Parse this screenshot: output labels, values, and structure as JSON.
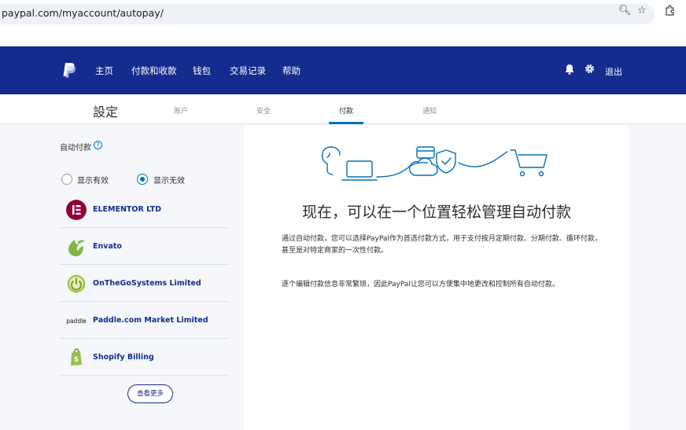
{
  "browser": {
    "url": "paypal.com/myaccount/autopay/",
    "zoom_icon": "zoom-icon",
    "bookmark_icon": "star-icon",
    "extensions_icon": "puzzle-icon"
  },
  "header": {
    "nav": [
      "主页",
      "付款和收款",
      "钱包",
      "交易记录",
      "帮助"
    ],
    "logout": "退出",
    "bg_color": "#142c8e"
  },
  "settings": {
    "title": "設定",
    "tabs": [
      "账户",
      "安全",
      "付款",
      "通知"
    ],
    "active_tab": "付款"
  },
  "left": {
    "autopay_label": "自动付款",
    "filters": [
      {
        "label": "显示有效",
        "checked": false
      },
      {
        "label": "显示无效",
        "checked": true
      }
    ],
    "merchants": [
      {
        "name": "ELEMENTOR LTD",
        "icon": "elementor-logo-icon"
      },
      {
        "name": "Envato",
        "icon": "envato-logo-icon"
      },
      {
        "name": "OnTheGoSystems Limited",
        "icon": "power-logo-icon"
      },
      {
        "name": "Paddle.com Market Limited",
        "icon": "paddle-logo-icon"
      },
      {
        "name": "Shopify Billing",
        "icon": "shopify-logo-icon"
      }
    ],
    "see_more": "查看更多"
  },
  "right": {
    "headline": "现在，可以在一个位置轻松管理自动付款",
    "para1": "通过自动付款，您可以选择PayPal作为首选付款方式，用于支付按月定期付款、分期付款、循环付款，甚至是对特定商家的一次性付款。",
    "para2": "逐个编辑付款信息非常繁琐，因此PayPal让您可以方便集中地更改和控制所有自动付款。"
  }
}
